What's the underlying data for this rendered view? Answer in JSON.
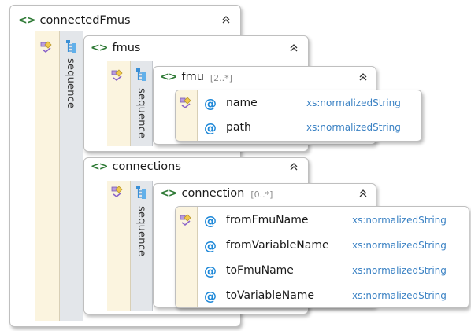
{
  "connectedFmus": {
    "name": "connectedFmus"
  },
  "fmus": {
    "name": "fmus",
    "group_label": "sequence"
  },
  "fmu": {
    "name": "fmu",
    "cardinality": "[2..*]",
    "group_label": "sequence",
    "attributes": [
      {
        "name": "name",
        "type": "xs:normalizedString"
      },
      {
        "name": "path",
        "type": "xs:normalizedString"
      }
    ]
  },
  "connections": {
    "name": "connections"
  },
  "connection": {
    "name": "connection",
    "cardinality": "[0..*]",
    "group_label": "sequence",
    "attributes": [
      {
        "name": "fromFmuName",
        "type": "xs:normalizedString"
      },
      {
        "name": "fromVariableName",
        "type": "xs:normalizedString"
      },
      {
        "name": "toFmuName",
        "type": "xs:normalizedString"
      },
      {
        "name": "toVariableName",
        "type": "xs:normalizedString"
      }
    ]
  },
  "outer_group_label": "sequence",
  "colors": {
    "element_icon": "#2f7a36",
    "attribute_icon": "#1e88d8",
    "type_text": "#3b82c4"
  },
  "icons": {
    "element": "element-icon",
    "attribute": "attribute-icon",
    "collapse": "collapse-icon",
    "attribute-group": "attribute-group-icon",
    "sequence": "sequence-icon"
  }
}
